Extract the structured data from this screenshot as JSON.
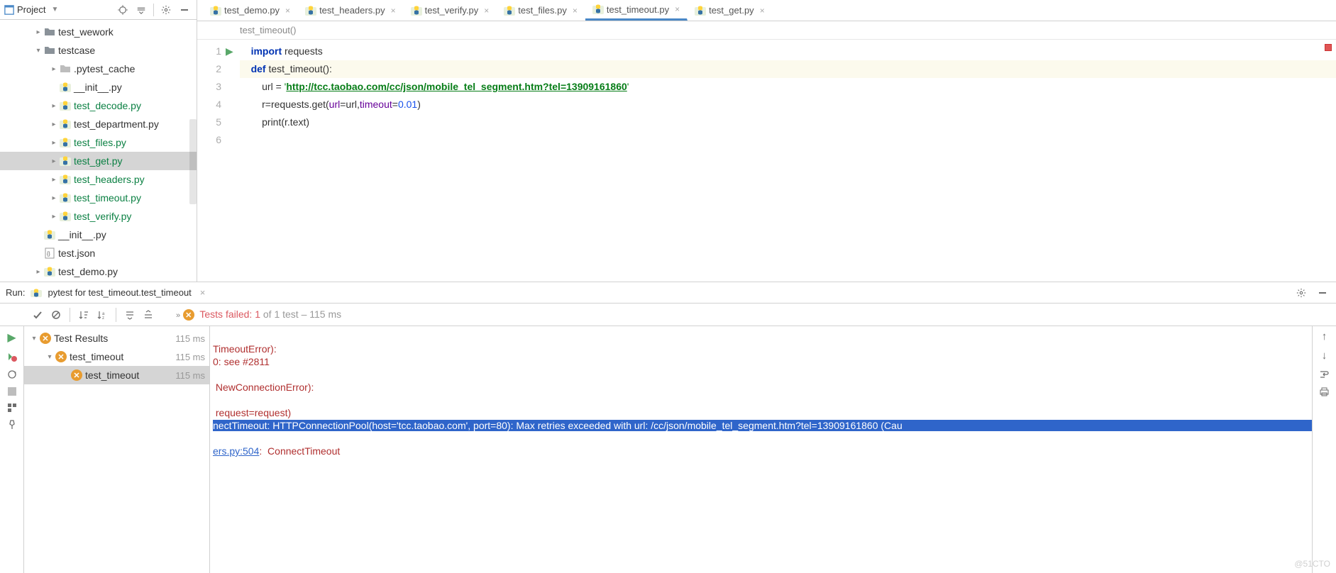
{
  "project_panel": {
    "title": "Project",
    "tree": [
      {
        "label": "test_wework",
        "type": "folder",
        "green": false,
        "indent": 1,
        "chev": "right"
      },
      {
        "label": "testcase",
        "type": "folder",
        "green": false,
        "indent": 1,
        "chev": "down"
      },
      {
        "label": ".pytest_cache",
        "type": "folder-grey",
        "green": false,
        "indent": 2,
        "chev": "right"
      },
      {
        "label": "__init__.py",
        "type": "py",
        "green": false,
        "indent": 2,
        "chev": ""
      },
      {
        "label": "test_decode.py",
        "type": "py",
        "green": true,
        "indent": 2,
        "chev": "right"
      },
      {
        "label": "test_department.py",
        "type": "py",
        "green": false,
        "indent": 2,
        "chev": "right"
      },
      {
        "label": "test_files.py",
        "type": "py",
        "green": true,
        "indent": 2,
        "chev": "right"
      },
      {
        "label": "test_get.py",
        "type": "py",
        "green": true,
        "indent": 2,
        "chev": "right",
        "selected": true
      },
      {
        "label": "test_headers.py",
        "type": "py",
        "green": true,
        "indent": 2,
        "chev": "right"
      },
      {
        "label": "test_timeout.py",
        "type": "py",
        "green": true,
        "indent": 2,
        "chev": "right"
      },
      {
        "label": "test_verify.py",
        "type": "py",
        "green": true,
        "indent": 2,
        "chev": "right"
      },
      {
        "label": "__init__.py",
        "type": "py",
        "green": false,
        "indent": 1,
        "chev": ""
      },
      {
        "label": "test.json",
        "type": "json",
        "green": false,
        "indent": 1,
        "chev": ""
      },
      {
        "label": "test_demo.py",
        "type": "py",
        "green": false,
        "indent": 1,
        "chev": "right"
      }
    ]
  },
  "tabs": [
    {
      "label": "test_demo.py",
      "active": false
    },
    {
      "label": "test_headers.py",
      "active": false
    },
    {
      "label": "test_verify.py",
      "active": false
    },
    {
      "label": "test_files.py",
      "active": false
    },
    {
      "label": "test_timeout.py",
      "active": true
    },
    {
      "label": "test_get.py",
      "active": false
    }
  ],
  "breadcrumb": "test_timeout()",
  "code": {
    "lines": [
      {
        "n": 1,
        "segs": [
          {
            "t": "    ",
            "c": ""
          },
          {
            "t": "import",
            "c": "kw"
          },
          {
            "t": " requests",
            "c": ""
          }
        ]
      },
      {
        "n": 2,
        "hl": true,
        "segs": [
          {
            "t": "    ",
            "c": ""
          },
          {
            "t": "def",
            "c": "kw"
          },
          {
            "t": " ",
            "c": ""
          },
          {
            "t": "test_timeout",
            "c": "fn"
          },
          {
            "t": "():",
            "c": ""
          }
        ]
      },
      {
        "n": 3,
        "segs": [
          {
            "t": "        url = ",
            "c": ""
          },
          {
            "t": "'",
            "c": "str"
          },
          {
            "t": "http://tcc.taobao.com/cc/json/mobile_tel_segment.htm?tel=13909161860",
            "c": "str link"
          },
          {
            "t": "'",
            "c": "str"
          }
        ]
      },
      {
        "n": 4,
        "segs": [
          {
            "t": "        r=requests.get(",
            "c": ""
          },
          {
            "t": "url",
            "c": "param"
          },
          {
            "t": "=url,",
            "c": ""
          },
          {
            "t": "timeout",
            "c": "param"
          },
          {
            "t": "=",
            "c": ""
          },
          {
            "t": "0.01",
            "c": "num"
          },
          {
            "t": ")",
            "c": ""
          }
        ]
      },
      {
        "n": 5,
        "segs": [
          {
            "t": "        print(r.text)",
            "c": ""
          }
        ]
      },
      {
        "n": 6,
        "segs": [
          {
            "t": "",
            "c": ""
          }
        ]
      }
    ]
  },
  "run_panel": {
    "header_label": "Run:",
    "config_name": "pytest for test_timeout.test_timeout",
    "tests_failed_prefix": "Tests failed: 1",
    "tests_failed_suffix": " of 1 test – 115 ms",
    "tree": [
      {
        "label": "Test Results",
        "time": "115 ms",
        "indent": 0,
        "chev": "down"
      },
      {
        "label": "test_timeout",
        "time": "115 ms",
        "indent": 1,
        "chev": "down"
      },
      {
        "label": "test_timeout",
        "time": "115 ms",
        "indent": 2,
        "chev": "",
        "selected": true
      }
    ],
    "console": {
      "l1": "TimeoutError):",
      "l2": "0: see #2811",
      "l3": " NewConnectionError):",
      "l4": " request=request)",
      "l5": "nectTimeout: HTTPConnectionPool(host='tcc.taobao.com', port=80): Max retries exceeded with url: /cc/json/mobile_tel_segment.htm?tel=13909161860 (Cau",
      "l6a": "ers.py:504",
      "l6b": ":  ConnectTimeout"
    }
  },
  "watermark": "@51CTO"
}
